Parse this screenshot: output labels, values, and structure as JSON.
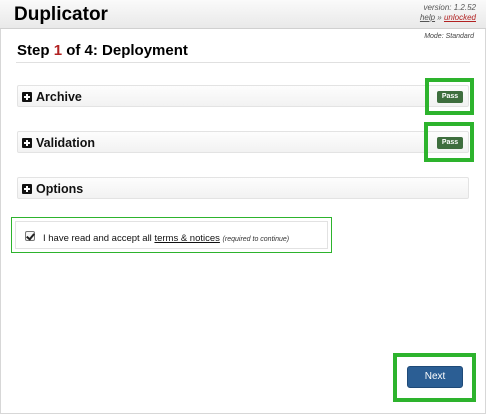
{
  "app": {
    "title": "Duplicator",
    "version": "version: 1.2.52",
    "help": "help",
    "separator": " » ",
    "unlocked": "unlocked",
    "mode": "Mode: Standard"
  },
  "step": {
    "prefix": "Step ",
    "number": "1",
    "suffix": " of 4: Deployment"
  },
  "sections": [
    {
      "label": "Archive",
      "status": "Pass"
    },
    {
      "label": "Validation",
      "status": "Pass"
    },
    {
      "label": "Options"
    }
  ],
  "accept": {
    "checked": true,
    "text_before": "I have read and accept all ",
    "terms_link": "terms & notices",
    "required_note": "(required to continue)"
  },
  "buttons": {
    "next": "Next"
  },
  "colors": {
    "highlight": "#2db32d",
    "pass_badge": "#3e6e3e",
    "next_button": "#2b5e94",
    "step_number": "#b22222"
  }
}
